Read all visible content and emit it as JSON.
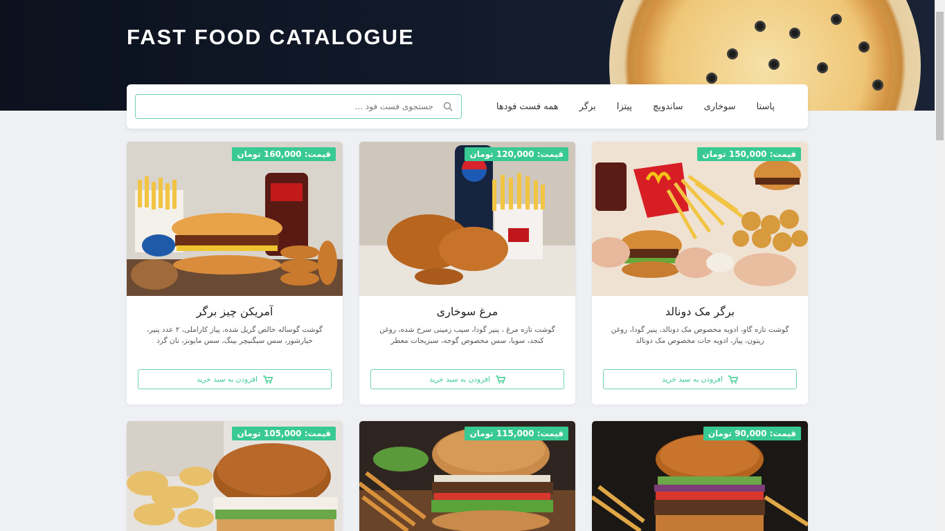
{
  "header": {
    "title": "FAST FOOD CATALOGUE"
  },
  "nav": {
    "items": [
      "همه فست فودها",
      "برگر",
      "پیتزا",
      "ساندویچ",
      "سوخاری",
      "پاستا"
    ]
  },
  "search": {
    "placeholder": "جستجوی فست فود ...",
    "value": ""
  },
  "products": [
    {
      "price": "قیمت: 160,000 تومان",
      "title": "آمریکن چیز برگر",
      "description": "گوشت گوساله خالص گریل شده، پیاز کاراملی، ۲ عدد پنیر، خیارشور، سس سیگنیچر بینگ، سس مایونز، نان گرد",
      "button": "افزودن به سبد خرید"
    },
    {
      "price": "قیمت: 120,000 تومان",
      "title": "مرغ سوخاری",
      "description": "گوشت تازه مرغ ، پنیر گودا، سیب زمینی سرخ شده، روغن کنجد، سویا، سس مخصوص گوجه، سبزیجات معطر",
      "button": "افزودن به سبد خرید"
    },
    {
      "price": "قیمت: 150,000 تومان",
      "title": "برگر مک دونالد",
      "description": "گوشت تازه گاو، ادویه مخصوص مک دونالد، پنیر گودا، روغن زیتون، پیاز، ادویه جات مخصوص مک دونالد",
      "button": "افزودن به سبد خرید"
    },
    {
      "price": "قیمت: 105,000 تومان"
    },
    {
      "price": "قیمت: 115,000 تومان"
    },
    {
      "price": "قیمت: 90,000 تومان"
    }
  ],
  "colors": {
    "accent": "#39c993",
    "hero_bg": "#0b111d",
    "page_bg": "#eef0f3"
  },
  "icons": {
    "search": "search-icon",
    "cart": "cart-icon"
  }
}
